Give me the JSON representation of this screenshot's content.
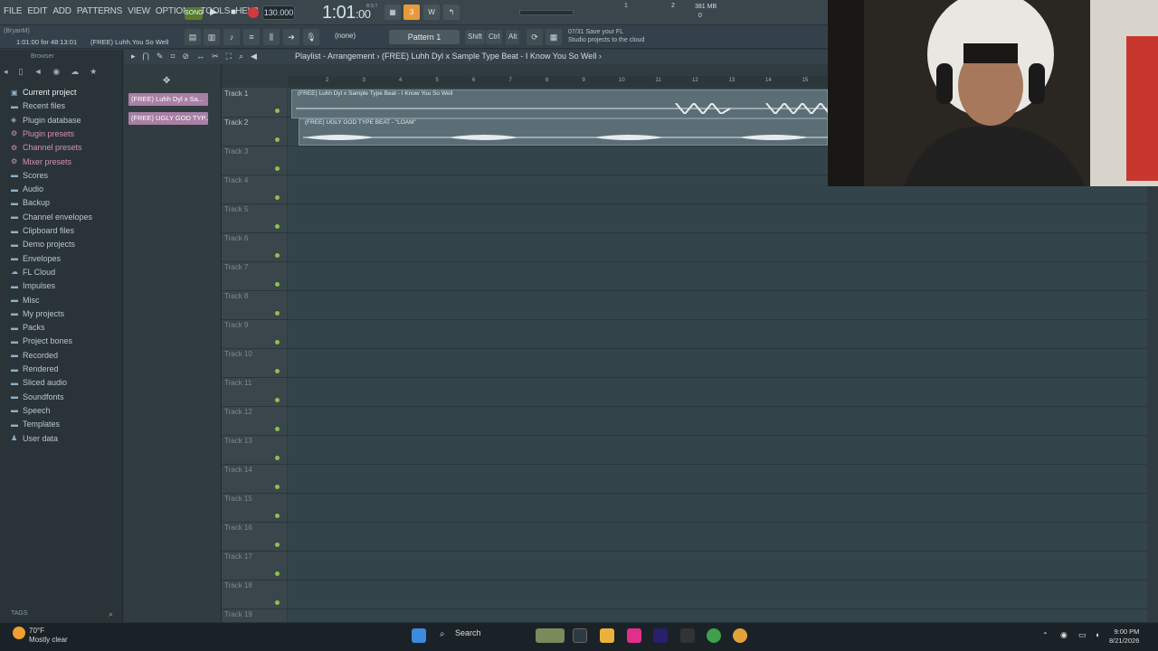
{
  "menu": [
    "FILE",
    "EDIT",
    "ADD",
    "PATTERNS",
    "VIEW",
    "OPTIONS",
    "TOOLS",
    "HELP"
  ],
  "transport": {
    "song_label": "SONG",
    "tempo": "130.000",
    "time": "1:01",
    "time_sub": ":00",
    "bst": "B:S:T"
  },
  "cpu": {
    "voices": "2",
    "ram": "381 MB",
    "poly": "0",
    "mem_label": "1"
  },
  "hintbar": {
    "project": "(BryanM)",
    "time_hint": "1:01:00 for 48:13:01",
    "file_hint": "(FREE) Luhh.You So Well"
  },
  "pattern_selector": {
    "none_label": "(none)",
    "pattern_label": "Pattern 1"
  },
  "keys": [
    "Shift",
    "Ctrl",
    "Alt"
  ],
  "cloud_notice": {
    "line1": "07/31  Save your FL",
    "line2": "Studio projects to the cloud"
  },
  "browser": {
    "title": "Browser",
    "items": [
      {
        "label": "Current project",
        "icon": "project-icon"
      },
      {
        "label": "Recent files",
        "icon": "folder-icon"
      },
      {
        "label": "Plugin database",
        "icon": "database-icon"
      },
      {
        "label": "Plugin presets",
        "icon": "plugin-icon"
      },
      {
        "label": "Channel presets",
        "icon": "plugin-icon"
      },
      {
        "label": "Mixer presets",
        "icon": "plugin-icon"
      },
      {
        "label": "Scores",
        "icon": "folder-icon"
      },
      {
        "label": "Audio",
        "icon": "folder-icon"
      },
      {
        "label": "Backup",
        "icon": "folder-icon"
      },
      {
        "label": "Channel envelopes",
        "icon": "folder-icon"
      },
      {
        "label": "Clipboard files",
        "icon": "folder-icon"
      },
      {
        "label": "Demo projects",
        "icon": "folder-icon"
      },
      {
        "label": "Envelopes",
        "icon": "folder-icon"
      },
      {
        "label": "FL Cloud",
        "icon": "cloud-icon"
      },
      {
        "label": "Impulses",
        "icon": "folder-icon"
      },
      {
        "label": "Misc",
        "icon": "folder-icon"
      },
      {
        "label": "My projects",
        "icon": "folder-icon"
      },
      {
        "label": "Packs",
        "icon": "folder-icon"
      },
      {
        "label": "Project bones",
        "icon": "folder-icon"
      },
      {
        "label": "Recorded",
        "icon": "folder-icon"
      },
      {
        "label": "Rendered",
        "icon": "folder-icon"
      },
      {
        "label": "Sliced audio",
        "icon": "folder-icon"
      },
      {
        "label": "Soundfonts",
        "icon": "folder-icon"
      },
      {
        "label": "Speech",
        "icon": "folder-icon"
      },
      {
        "label": "Templates",
        "icon": "folder-icon"
      },
      {
        "label": "User data",
        "icon": "user-icon"
      }
    ],
    "tags_label": "TAGS"
  },
  "picker": {
    "items": [
      "(FREE) Luhh Dyl x Sa...",
      "(FREE) UGLY GOD TYP..."
    ]
  },
  "playlist": {
    "title": "Playlist - Arrangement › (FREE) Luhh Dyl x Sample Type Beat - I Know You So Well ›",
    "ruler": [
      "2",
      "3",
      "4",
      "5",
      "6",
      "7",
      "8",
      "9",
      "10",
      "11",
      "12",
      "13",
      "14",
      "15"
    ],
    "tracks": [
      "Track 1",
      "Track 2",
      "Track 3",
      "Track 4",
      "Track 5",
      "Track 6",
      "Track 7",
      "Track 8",
      "Track 9",
      "Track 10",
      "Track 11",
      "Track 12",
      "Track 13",
      "Track 14",
      "Track 15",
      "Track 16",
      "Track 17",
      "Track 18",
      "Track 19"
    ],
    "clips": [
      {
        "title": "(FREE) Luhh Dyl x Sample Type Beat - I Know You So Well"
      },
      {
        "title": "(FREE) UGLY GOD TYPE BEAT - \"LOAM\""
      }
    ]
  },
  "taskbar": {
    "weather_temp": "70°F",
    "weather_desc": "Mostly clear",
    "search_label": "Search",
    "time": "9:00 PM",
    "date": "8/21/2026"
  },
  "colors": {
    "accent_orange": "#e79a3c",
    "song_green": "#5a7b2e",
    "clip_pink": "#a97fa5",
    "track_dot": "#8bc34a"
  }
}
